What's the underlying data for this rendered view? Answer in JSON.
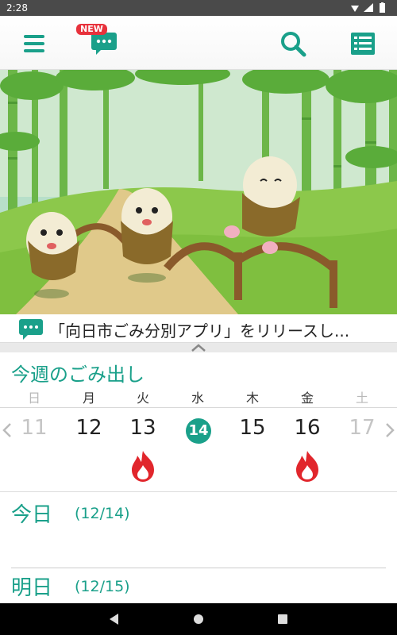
{
  "status_bar": {
    "time": "2:28"
  },
  "app_bar": {
    "new_badge": "NEW",
    "colors": {
      "accent": "#1aa08a",
      "badge": "#e8323c"
    }
  },
  "ticker": {
    "text": "「向日市ごみ分別アプリ」をリリースし..."
  },
  "week": {
    "title": "今週のごみ出し",
    "weekdays": [
      "日",
      "月",
      "火",
      "水",
      "木",
      "金",
      "土"
    ],
    "dates": [
      "11",
      "12",
      "13",
      "14",
      "15",
      "16",
      "17"
    ],
    "today_index": 3,
    "burnable_days": [
      "13",
      "16"
    ]
  },
  "panel": {
    "today_label": "今日",
    "today_date": "(12/14)",
    "tomorrow_label": "明日",
    "tomorrow_date": "(12/15)"
  }
}
